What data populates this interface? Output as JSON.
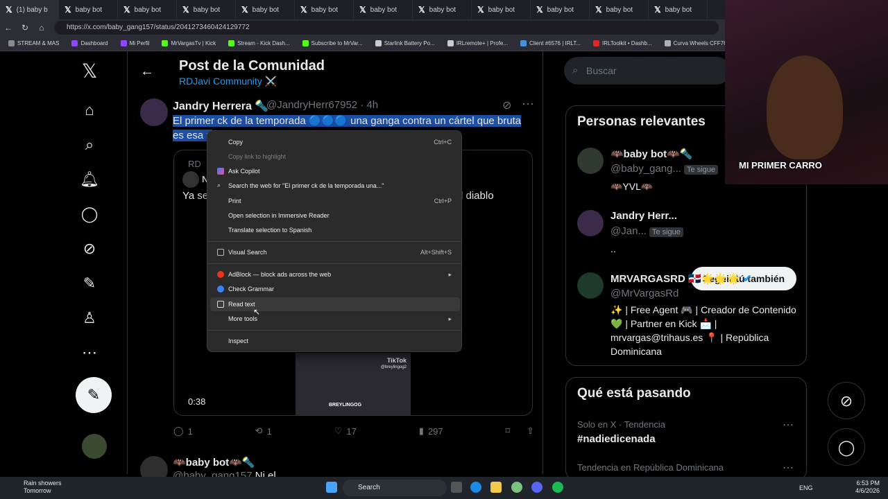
{
  "browser": {
    "tabs": [
      {
        "label": "(1) baby b"
      },
      {
        "label": "baby bot"
      },
      {
        "label": "baby bot"
      },
      {
        "label": "baby bot"
      },
      {
        "label": "baby bot"
      },
      {
        "label": "baby bot"
      },
      {
        "label": "baby bot"
      },
      {
        "label": "baby bot"
      },
      {
        "label": "baby bot"
      },
      {
        "label": "baby bot"
      },
      {
        "label": "baby bot"
      },
      {
        "label": "baby bot"
      }
    ],
    "url": "https://x.com/baby_gang157/status/2041273460424129772",
    "bookmarks": [
      "STREAM & MAS",
      "Dashboard",
      "Mi Perfil",
      "MrVargasTv | Kick",
      "Stream - Kick Dash...",
      "Subscribe to MrVar...",
      "Starlink Battery Po...",
      "IRLremote+ | Profe...",
      "Client #6576 | IRLT...",
      "IRLToolkit • Dashb...",
      "Curva Wheels CFF76"
    ]
  },
  "header": {
    "title": "Post de la Comunidad",
    "community": "RDJavi Community ⚔️"
  },
  "post": {
    "author": "Jandry Herrera 🔦",
    "handle": "@JandryHerr67952 · 4h",
    "text_line1": "El primer ck de la temporada 🔵🔵🔵 una ganga contra un cártel que bruta",
    "text_line2": "es esa p",
    "quote_text": "Ya se",
    "quote_text2": "l diablo",
    "quote_initial": "RD",
    "quote_author": "N",
    "video_duration": "0:38",
    "video_brand": "TikTok",
    "video_handle": "@breylingog2",
    "video_watermark": "BREYLINGOG",
    "replies": "1",
    "reposts": "1",
    "likes": "17",
    "views": "297",
    "next_author": "🦇baby bot🦇🔦",
    "next_handle": "@baby_gang157",
    "next_extra": "Ni el"
  },
  "context_menu": {
    "items": [
      {
        "label": "Copy",
        "shortcut": "Ctrl+C"
      },
      {
        "label": "Copy link to highlight",
        "shortcut": ""
      },
      {
        "label": "Ask Copilot",
        "shortcut": ""
      },
      {
        "label": "Search the web for \"El primer ck de la temporada  una...\"",
        "shortcut": ""
      },
      {
        "label": "Print",
        "shortcut": "Ctrl+P"
      },
      {
        "label": "Open selection in Immersive Reader",
        "shortcut": ""
      },
      {
        "label": "Translate selection to Spanish",
        "shortcut": ""
      },
      {
        "label": "Visual Search",
        "shortcut": "Alt+Shift+S"
      },
      {
        "label": "AdBlock — block ads across the web",
        "shortcut": ""
      },
      {
        "label": "Check Grammar",
        "shortcut": ""
      },
      {
        "label": "Read text",
        "shortcut": ""
      },
      {
        "label": "More tools",
        "shortcut": ""
      },
      {
        "label": "Inspect",
        "shortcut": ""
      }
    ]
  },
  "sidebar": {
    "search_placeholder": "Buscar",
    "relevant_title": "Personas relevantes",
    "people": [
      {
        "name": "🦇baby bot🦇🔦",
        "handle": "@baby_gang...",
        "badge": "Te sigue",
        "bio": "🦇YVL🦇"
      },
      {
        "name": "Jandry Herr...",
        "handle": "@Jan...",
        "badge": "Te sigue",
        "bio": ".."
      },
      {
        "name": "MRVARGASRD 🇩🇴🌟🌟🌟",
        "handle": "@MrVargasRd",
        "badge": "",
        "bio": "✨ | Free Agent 🎮 | Creador de Contenido 💚 | Partner en Kick 📩 | mrvargas@trihaus.es 📍 | República Dominicana"
      }
    ],
    "follow_label": "Seguir tú también",
    "trending_title": "Qué está pasando",
    "trends": [
      {
        "context": "Solo en X · Tendencia",
        "name": "#nadiedicenada"
      },
      {
        "context": "Tendencia en República Dominicana",
        "name": ""
      }
    ]
  },
  "webcam": {
    "overlay_text": "MI PRIMER CARRO"
  },
  "taskbar": {
    "weather_title": "Rain showers",
    "weather_sub": "Tomorrow",
    "search_label": "Search",
    "lang": "ENG",
    "time": "6:53 PM",
    "date": "4/6/2026"
  },
  "colors": {
    "accent": "#1d9bf0",
    "selection": "#1d4fa5",
    "background": "#000000"
  }
}
